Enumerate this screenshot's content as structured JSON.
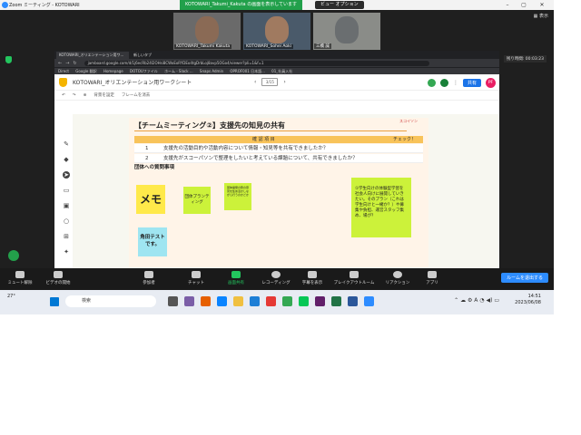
{
  "window": {
    "title": "Zoom ミーティング - KOTOWARI",
    "sharing_banner": "KOTOWARI_Takumi_Kakuta の画面を表示しています",
    "view_options": "ビュー オプション",
    "display_btn": "表示",
    "timer": "残り時間: 00:03:23"
  },
  "participants": [
    {
      "name": "KOTOWARI_Takumi Kakuta"
    },
    {
      "name": "KOTOWARI_Sohei Aoki"
    },
    {
      "name": "三橋 誠"
    }
  ],
  "browser": {
    "tabs": [
      "KOTOWARI_オリエンテーション用ワ...",
      "新しいタブ"
    ],
    "url": "jamboard.google.com/d/1j6ecRb24I2OHsi8CWoEoRYDEo4tgDrbLoj8avp5OGo4/viewer?pli=1&f=1",
    "bookmarks": [
      "Direct",
      "Google 翻訳",
      "Homepage",
      "DOTOUファイル",
      "ホーム - Slack ...",
      "Snaps Admin",
      "OPROF001 日本語...",
      "01_社員入社"
    ]
  },
  "jamboard": {
    "title": "KOTOWARI_オリエンテーション用ワークシート",
    "page": "3/15",
    "share_label": "共有",
    "avatar": "PF",
    "toolbar": [
      "背景を設定",
      "フレームを消去"
    ]
  },
  "sheet": {
    "title": "【チームミーティング②】支援先の知見の共有",
    "brand": "スコイソン",
    "table_header_item": "確 認 項 目",
    "table_header_check": "チェック！",
    "rows": [
      {
        "num": "1",
        "text": "支援先の活動目的や活動内容について情報・知見等を共有できましたか？"
      },
      {
        "num": "2",
        "text": "支援先がスコーパソンで整理をしたいと考えている課題について、共有できましたか？"
      }
    ],
    "section": "団体への質問事項",
    "sticky_memo": "メモ",
    "sticky_group": "団体プランティング",
    "sticky_small": "団体開発の際の意見を集め活かしながら行うのかどか",
    "sticky_kado": "角田テストです。",
    "sticky_long": "①学生向けの体験型学習を社会人向けに展開していきたい。そのプラン（これは学生向けと一緒か？）や募集や負担、運営スタッフ集め、場が？"
  },
  "footer": {
    "buttons": [
      "ミュート解除",
      "ビデオの開始",
      "参加者",
      "チャット",
      "画面共有",
      "レコーディング",
      "字幕を表示",
      "ブレイクアウトルーム",
      "リアクション",
      "アプリ"
    ],
    "participants_count": "4",
    "leave": "ルームを退出する"
  },
  "taskbar": {
    "weather": "27°",
    "search_placeholder": "検索",
    "time": "14:51",
    "date": "2023/06/08"
  }
}
